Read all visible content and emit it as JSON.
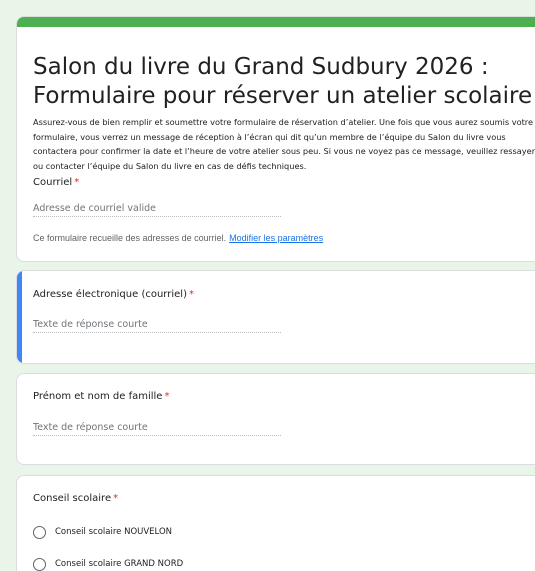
{
  "colors": {
    "background": "#eaf5ea",
    "header_accent": "#4caf50",
    "active_accent": "#4285f4",
    "required": "#d93025",
    "link": "#1a73e8"
  },
  "form": {
    "title": "Salon du livre du Grand Sudbury 2026 : Formulaire pour réserver un atelier scolaire",
    "description": "Assurez-vous de bien remplir et soumettre votre formulaire de réservation d’atelier. Une fois que vous aurez soumis votre formulaire, vous verrez un message de réception à l’écran qui dit qu’un membre de l’équipe du Salon du livre vous contactera pour confirmer la date et l’heure de votre atelier sous peu. Si vous ne voyez pas ce message, veuillez ressayer ou contacter l’équipe du Salon du livre en cas de défis techniques.",
    "email_label": "Courriel",
    "email_placeholder": "Adresse de courriel valide",
    "collect_note": "Ce formulaire recueille des adresses de courriel.",
    "collect_link": "Modifier les paramètres",
    "required_mark": "*"
  },
  "questions": [
    {
      "label": "Adresse électronique (courriel)",
      "placeholder": "Texte de réponse courte"
    },
    {
      "label": "Prénom et nom de famille",
      "placeholder": "Texte de réponse courte"
    },
    {
      "label": "Conseil scolaire",
      "options": [
        "Conseil scolaire NOUVELON",
        "Conseil scolaire GRAND NORD"
      ]
    }
  ]
}
